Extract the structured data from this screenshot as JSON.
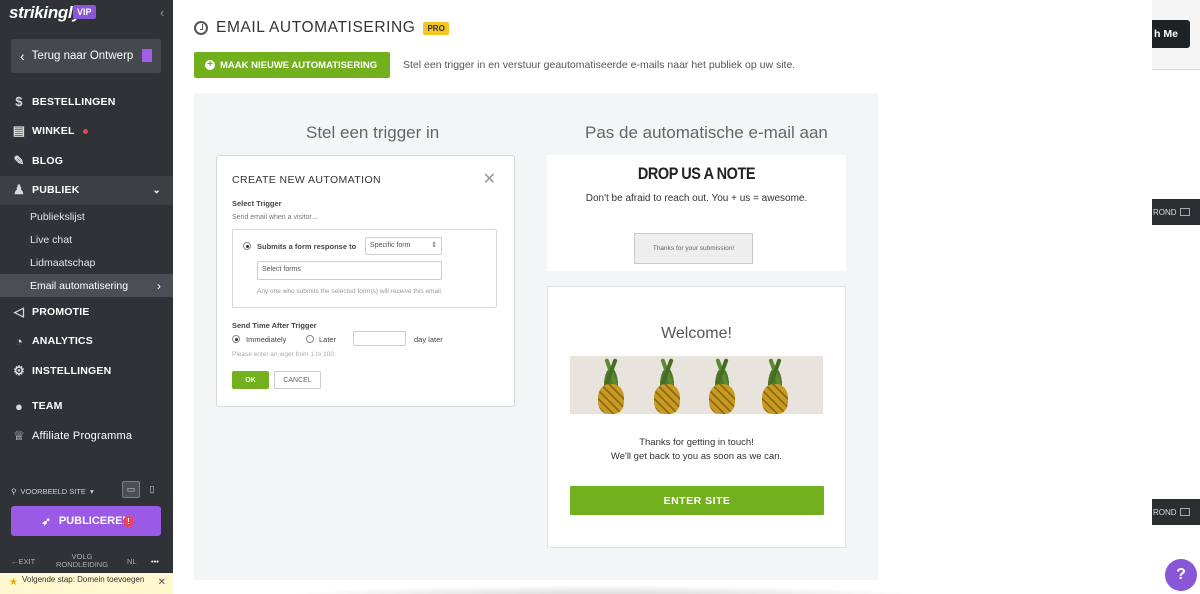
{
  "sidebar": {
    "logo": "strikingly",
    "vip": "VIP",
    "back": "Terug naar Ontwerp",
    "items": [
      {
        "label": "BESTELLINGEN",
        "icon": "dollar-circle-icon"
      },
      {
        "label": "WINKEL",
        "icon": "shop-icon"
      },
      {
        "label": "BLOG",
        "icon": "pen-icon"
      },
      {
        "label": "PUBLIEK",
        "icon": "people-icon"
      },
      {
        "label": "PROMOTIE",
        "icon": "megaphone-icon"
      },
      {
        "label": "ANALYTICS",
        "icon": "pie-chart-icon"
      },
      {
        "label": "INSTELLINGEN",
        "icon": "gear-icon"
      },
      {
        "label": "TEAM",
        "icon": "team-icon"
      },
      {
        "label": "Affiliate Programma",
        "icon": "trophy-icon"
      }
    ],
    "sub_items": [
      "Publiekslijst",
      "Live chat",
      "Lidmaatschap",
      "Email automatisering"
    ],
    "preview": "VOORBEELD SITE",
    "publish": "PUBLICEREN",
    "exit": "EXIT",
    "tour": "VOLG RONDLEIDING",
    "lang": "NL",
    "more": "•••",
    "next_step": "Volgende stap: Domein toevoegen"
  },
  "main": {
    "title": "EMAIL AUTOMATISERING",
    "pro": "PRO",
    "new_button": "MAAK NIEUWE AUTOMATISERING",
    "description": "Stel een trigger in en verstuur geautomatiseerde e-mails naar het publiek op uw site.",
    "left_heading": "Stel een trigger in",
    "right_heading": "Pas de automatische e-mail aan"
  },
  "modal": {
    "title": "CREATE NEW AUTOMATION",
    "select_trigger": "Select Trigger",
    "send_when": "Send email when a visitor...",
    "option": "Submits a form response to",
    "form_select": "Specific form",
    "forms_placeholder": "Select forms",
    "hint": "Any one who submits the selected form(s) will receive this email.",
    "send_time": "Send Time After Trigger",
    "immediately": "Immediately",
    "later": "Later",
    "day_later": "day later",
    "integer_hint": "Please enter an ieger  from 1 to 100.",
    "ok": "OK",
    "cancel": "CANCEL"
  },
  "preview": {
    "drop": "DROP US A NOTE",
    "afraid": "Don't be afraid to reach out. You + us = awesome.",
    "thanks_box": "Thanks for your submission!",
    "welcome": "Welcome!",
    "thanks_line1": "Thanks for getting in touch!",
    "thanks_line2": "We'll get back to you as soon as we can.",
    "enter": "ENTER SITE"
  },
  "backdrop": {
    "me_button": "h Me",
    "rond": "ROND",
    "help": "?"
  },
  "colors": {
    "accent_green": "#72b01d",
    "purple": "#9a5ae6",
    "sidebar": "#2f3236"
  }
}
